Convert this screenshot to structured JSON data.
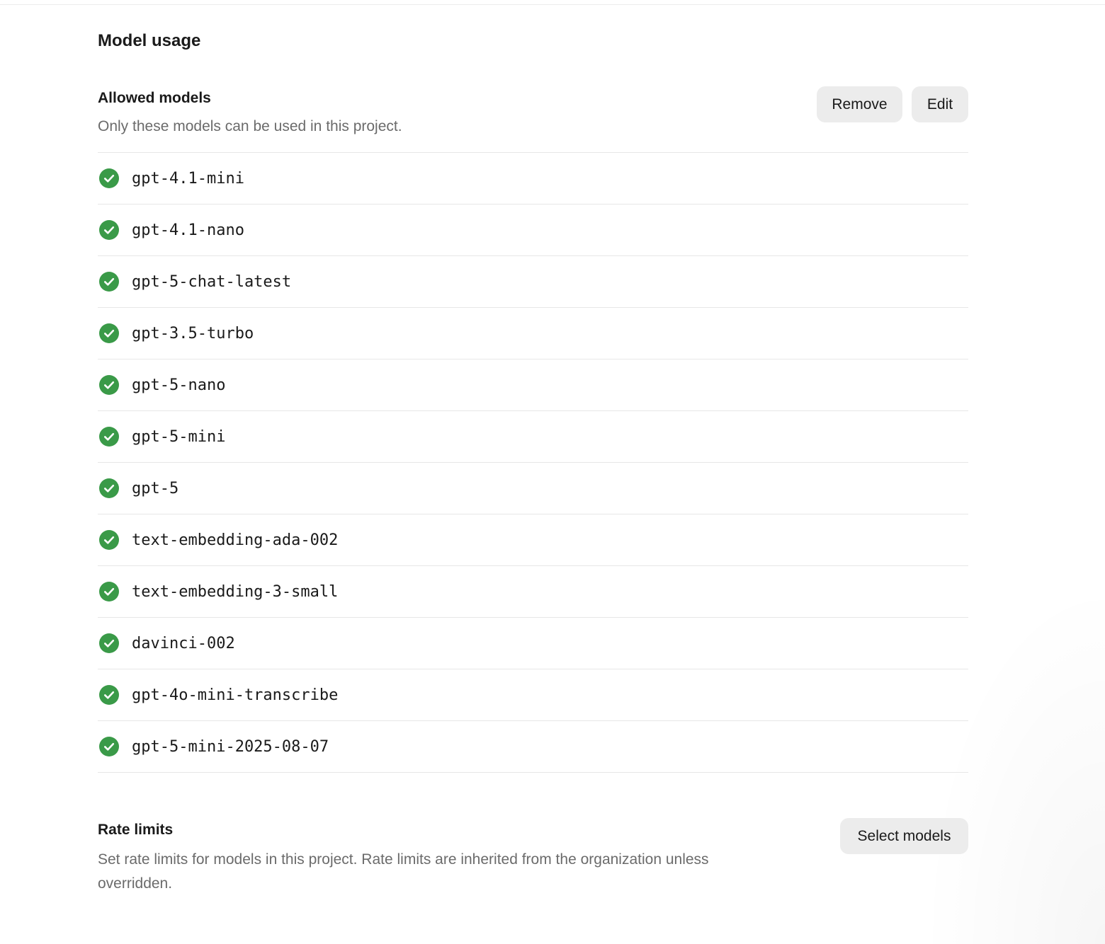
{
  "model_usage": {
    "title": "Model usage",
    "allowed_models": {
      "title": "Allowed models",
      "description": "Only these models can be used in this project.",
      "remove_label": "Remove",
      "edit_label": "Edit",
      "status_icon": "check-circle-icon",
      "status_color": "#3a9a48",
      "models": [
        {
          "name": "gpt-4.1-mini"
        },
        {
          "name": "gpt-4.1-nano"
        },
        {
          "name": "gpt-5-chat-latest"
        },
        {
          "name": "gpt-3.5-turbo"
        },
        {
          "name": "gpt-5-nano"
        },
        {
          "name": "gpt-5-mini"
        },
        {
          "name": "gpt-5"
        },
        {
          "name": "text-embedding-ada-002"
        },
        {
          "name": "text-embedding-3-small"
        },
        {
          "name": "davinci-002"
        },
        {
          "name": "gpt-4o-mini-transcribe"
        },
        {
          "name": "gpt-5-mini-2025-08-07"
        }
      ]
    },
    "rate_limits": {
      "title": "Rate limits",
      "description": "Set rate limits for models in this project. Rate limits are inherited from the organization unless overridden.",
      "select_models_label": "Select models"
    }
  }
}
